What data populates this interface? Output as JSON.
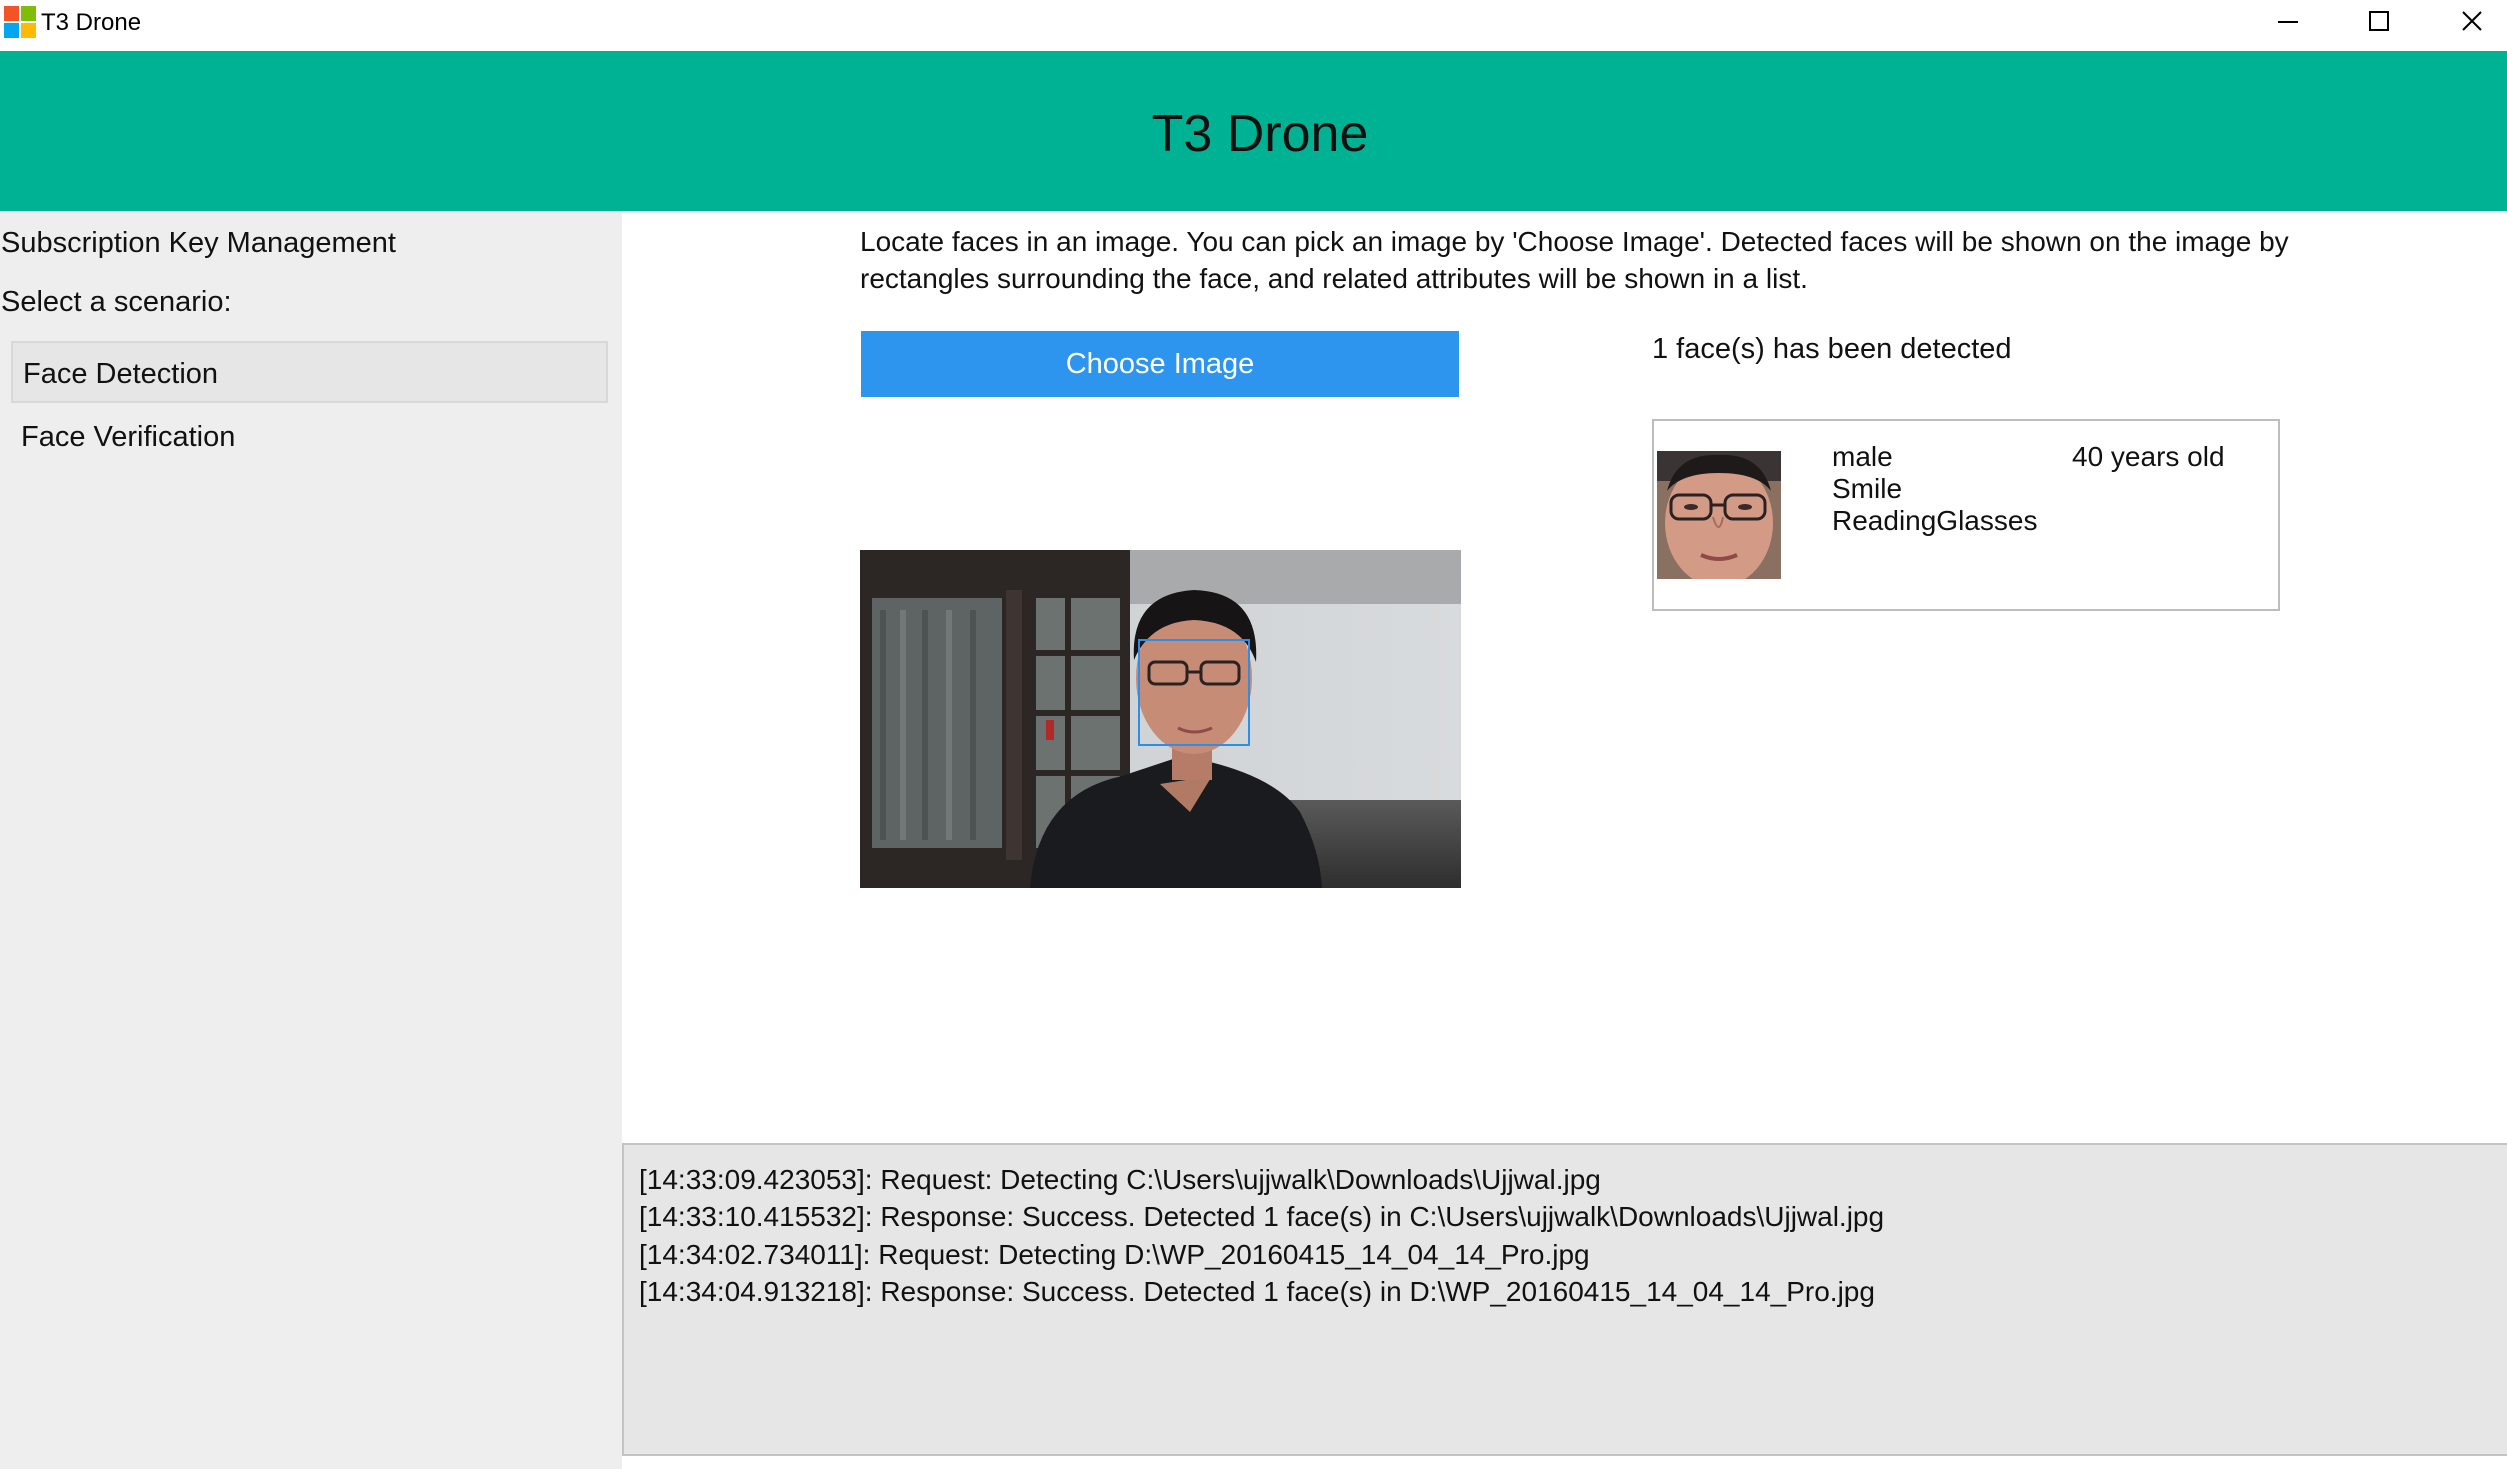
{
  "window": {
    "title": "T3 Drone",
    "controls": [
      "minimize",
      "maximize",
      "close"
    ]
  },
  "header": {
    "title": "T3 Drone",
    "background": "#00b294"
  },
  "sidebar": {
    "subscription_link": "Subscription Key Management",
    "scenario_prompt": "Select a scenario:",
    "items": [
      {
        "label": "Face Detection",
        "selected": true
      },
      {
        "label": "Face Verification",
        "selected": false
      }
    ]
  },
  "main": {
    "description": "Locate faces in an image. You can pick an image by 'Choose Image'. Detected faces will be shown on the image by rectangles surrounding the face, and related attributes will be shown in a list.",
    "choose_button": "Choose Image",
    "detected_count": "1 face(s) has been detected",
    "faces": [
      {
        "gender": "male",
        "expression": "Smile",
        "glasses": "ReadingGlasses",
        "age": "40 years old"
      }
    ]
  },
  "log": {
    "lines": [
      "[14:33:09.423053]: Request: Detecting C:\\Users\\ujjwalk\\Downloads\\Ujjwal.jpg",
      "[14:33:10.415532]: Response: Success. Detected 1 face(s) in C:\\Users\\ujjwalk\\Downloads\\Ujjwal.jpg",
      "[14:34:02.734011]: Request: Detecting D:\\WP_20160415_14_04_14_Pro.jpg",
      "[14:34:04.913218]: Response: Success. Detected 1 face(s) in D:\\WP_20160415_14_04_14_Pro.jpg"
    ]
  },
  "colors": {
    "accent_button": "#2e95ef",
    "face_rectangle": "#2e8ee6",
    "sidebar_bg": "#eeeeee",
    "log_bg": "#e6e6e6"
  }
}
